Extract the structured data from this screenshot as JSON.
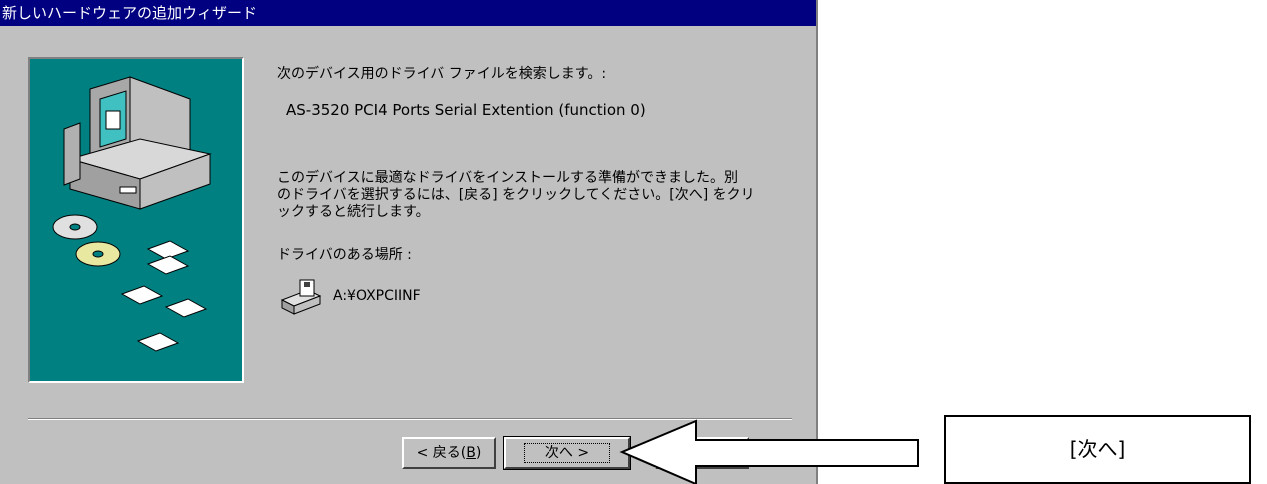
{
  "window": {
    "title": "新しいハードウェアの追加ウィザード"
  },
  "content": {
    "search_heading": "次のデバイス用のドライバ ファイルを検索します。:",
    "device_name": "AS-3520 PCI4 Ports Serial Extention (function 0)",
    "ready_line1": "このデバイスに最適なドライバをインストールする準備ができました。別",
    "ready_line2": "のドライバを選択するには、[戻る] をクリックしてください。[次へ] をクリ",
    "ready_line3": "ックすると続行します。",
    "location_label": "ドライバのある場所 :",
    "location_path": "A:¥OXPCIINF"
  },
  "buttons": {
    "back_label": "< 戻る(",
    "back_key": "B",
    "back_close": ")",
    "next_label": "次へ >"
  },
  "annotation": {
    "callout_text": "[次へ]"
  },
  "icons": {
    "illustration": "computer-with-disks-illustration",
    "drive": "floppy-drive-icon",
    "arrow": "left-pointing-arrow"
  },
  "colors": {
    "titlebar": "#000080",
    "window_face": "#c0c0c0",
    "illustration_bg": "#008080"
  }
}
